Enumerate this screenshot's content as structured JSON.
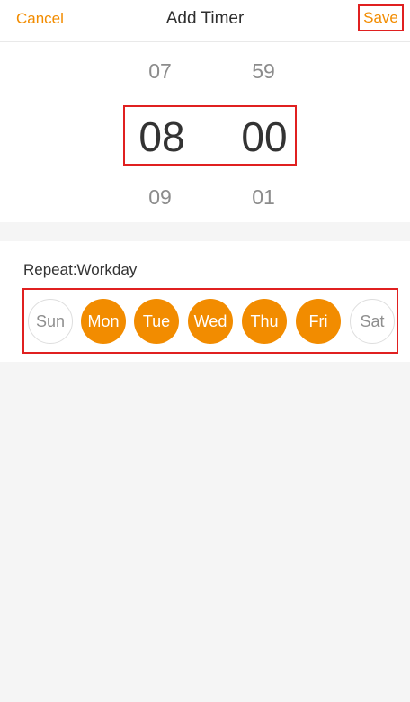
{
  "header": {
    "cancel_label": "Cancel",
    "title": "Add Timer",
    "save_label": "Save"
  },
  "picker": {
    "hours": {
      "prev": "07",
      "selected": "08",
      "next": "09"
    },
    "minutes": {
      "prev": "59",
      "selected": "00",
      "next": "01"
    }
  },
  "repeat": {
    "label": "Repeat:Workday",
    "days": [
      {
        "label": "Sun",
        "selected": false
      },
      {
        "label": "Mon",
        "selected": true
      },
      {
        "label": "Tue",
        "selected": true
      },
      {
        "label": "Wed",
        "selected": true
      },
      {
        "label": "Thu",
        "selected": true
      },
      {
        "label": "Fri",
        "selected": true
      },
      {
        "label": "Sat",
        "selected": false
      }
    ]
  },
  "colors": {
    "accent": "#f28c00",
    "highlight_border": "#e02020",
    "background_gray": "#f5f5f5"
  }
}
